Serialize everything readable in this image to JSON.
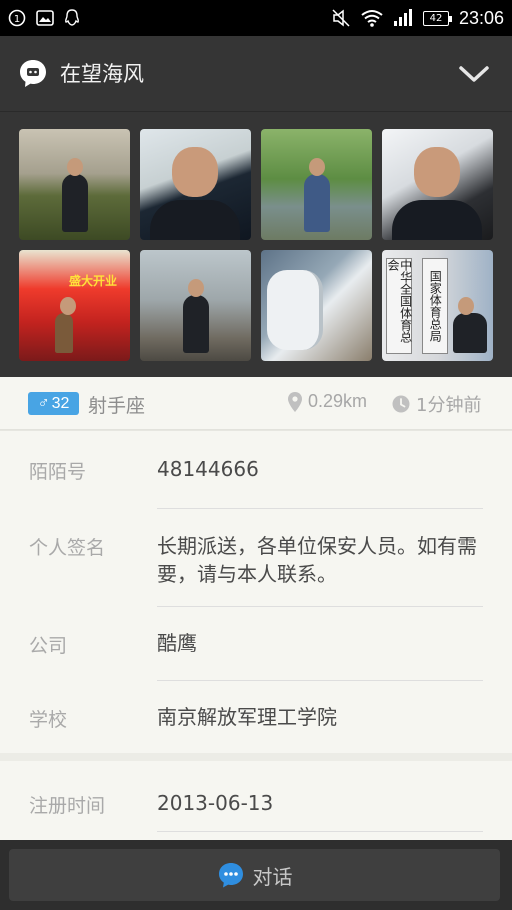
{
  "status_bar": {
    "time": "23:06",
    "battery": "42",
    "left_icons": [
      "notification-1-icon",
      "image-icon",
      "qq-icon"
    ],
    "right_icons": [
      "mute-icon",
      "wifi-icon",
      "signal-icon",
      "battery-icon"
    ]
  },
  "header": {
    "title": "在望海风",
    "icon": "chat-bubble-icon",
    "expand_icon": "chevron-down-icon"
  },
  "photos": {
    "count": 8,
    "p5_caption": "盛大开业",
    "p8_sign_left": "中华全国体育总会",
    "p8_sign_right": "国家体育总局"
  },
  "profile_summary": {
    "gender_symbol": "♂",
    "age": "32",
    "zodiac": "射手座",
    "distance": "0.29km",
    "last_active": "1分钟前"
  },
  "details": [
    {
      "label": "陌陌号",
      "value": "48144666"
    },
    {
      "label": "个人签名",
      "value": "长期派送，各单位保安人员。如有需要，请与本人联系。"
    },
    {
      "label": "公司",
      "value": "酷鹰"
    },
    {
      "label": "学校",
      "value": "南京解放军理工学院"
    }
  ],
  "details_extra": [
    {
      "label": "注册时间",
      "value": "2013-06-13"
    }
  ],
  "bottom_bar": {
    "chat_label": "对话",
    "chat_icon": "chat-bubble-icon"
  },
  "colors": {
    "badge": "#48a4e4",
    "chat_icon": "#2f8ee0",
    "header_bg": "#353535",
    "panel_bg": "#f6f6f1"
  }
}
